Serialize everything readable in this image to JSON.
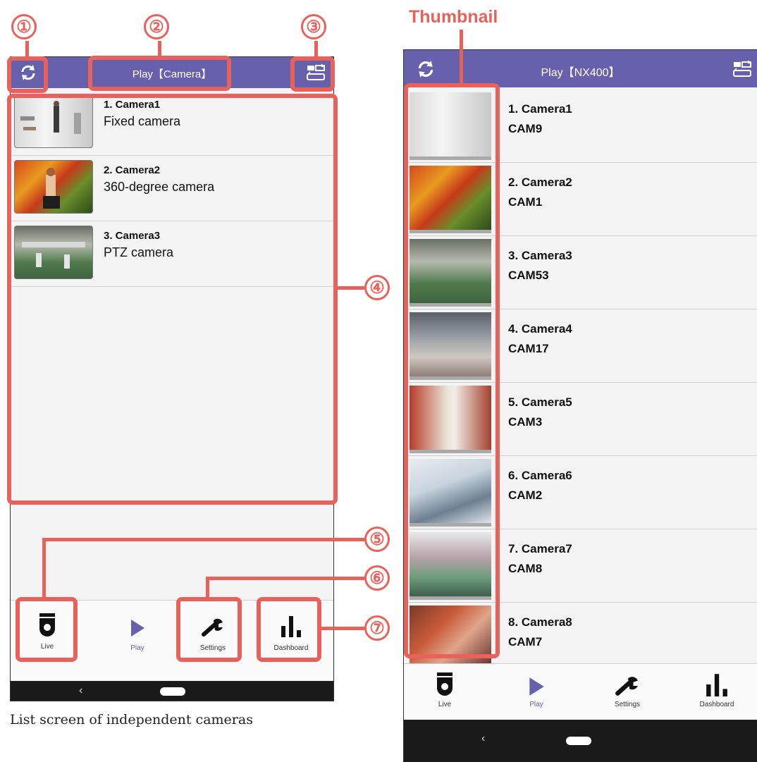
{
  "left_screen": {
    "title": "Play【Camera】",
    "icons": {
      "left": "refresh-icon",
      "right": "switch-recorder-icon"
    },
    "cameras": [
      {
        "label": "1. Camera1",
        "type": "Fixed camera"
      },
      {
        "label": "2. Camera2",
        "type": "360-degree camera"
      },
      {
        "label": "3. Camera3",
        "type": "PTZ camera"
      }
    ],
    "nav": {
      "live": "Live",
      "play": "Play",
      "settings": "Settings",
      "dashboard": "Dashboard"
    },
    "caption": "List screen of independent cameras"
  },
  "right_screen": {
    "heading": "Thumbnail",
    "title": "Play【NX400】",
    "cameras": [
      {
        "label": "1. Camera1",
        "channel": "CAM9"
      },
      {
        "label": "2. Camera2",
        "channel": "CAM1"
      },
      {
        "label": "3. Camera3",
        "channel": "CAM53"
      },
      {
        "label": "4. Camera4",
        "channel": "CAM17"
      },
      {
        "label": "5. Camera5",
        "channel": "CAM3"
      },
      {
        "label": "6. Camera6",
        "channel": "CAM2"
      },
      {
        "label": "7. Camera7",
        "channel": "CAM8"
      },
      {
        "label": "8. Camera8",
        "channel": "CAM7"
      }
    ],
    "nav": {
      "live": "Live",
      "play": "Play",
      "settings": "Settings",
      "dashboard": "Dashboard"
    }
  },
  "callouts": [
    "①",
    "②",
    "③",
    "④",
    "⑤",
    "⑥",
    "⑦"
  ],
  "colors": {
    "appbar": "#6760ad",
    "highlight": "#e8615a",
    "active_tab": "#6760ad",
    "system_bar": "#1a1a1a"
  },
  "system_bar": {
    "back": "‹"
  }
}
